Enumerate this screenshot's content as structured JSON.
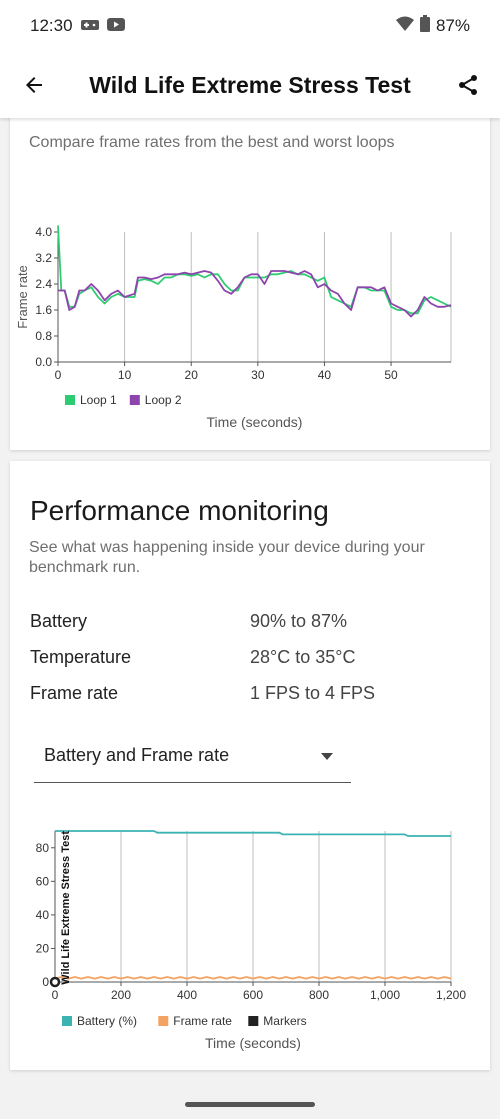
{
  "status_bar": {
    "time": "12:30",
    "battery": "87%"
  },
  "app_bar": {
    "title": "Wild Life Extreme Stress Test"
  },
  "loops_card": {
    "subtitle": "Compare frame rates from the best and worst loops"
  },
  "perf_card": {
    "title": "Performance monitoring",
    "subtitle_line1": "See what was happening inside your device during your",
    "subtitle_line2": "benchmark run.",
    "stats": {
      "battery_label": "Battery",
      "battery_value": "90% to 87%",
      "temperature_label": "Temperature",
      "temperature_value": "28°C to 35°C",
      "framerate_label": "Frame rate",
      "framerate_value": "1 FPS to 4 FPS"
    },
    "dropdown": {
      "selected": "Battery and Frame rate"
    }
  },
  "chart_data": [
    {
      "type": "line",
      "title": "",
      "xlabel": "Time (seconds)",
      "ylabel": "Frame rate",
      "xlim": [
        0,
        59
      ],
      "ylim": [
        0,
        4.0
      ],
      "x_ticks": [
        "0",
        "10",
        "20",
        "30",
        "40",
        "50"
      ],
      "y_ticks": [
        "0.0",
        "0.8",
        "1.6",
        "2.4",
        "3.2",
        "4.0"
      ],
      "legend_position": "bottom-left",
      "grid": "vertical",
      "series": [
        {
          "name": "Loop 1",
          "color": "#2ecc71",
          "points": [
            [
              0,
              4.2
            ],
            [
              0.5,
              2.2
            ],
            [
              1,
              2.2
            ],
            [
              1.7,
              1.7
            ],
            [
              2.5,
              1.7
            ],
            [
              3.2,
              2.1
            ],
            [
              4,
              2.2
            ],
            [
              5,
              2.3
            ],
            [
              6,
              2.0
            ],
            [
              7,
              1.8
            ],
            [
              8,
              2.0
            ],
            [
              9,
              2.1
            ],
            [
              10,
              2.0
            ],
            [
              11.5,
              2.0
            ],
            [
              12,
              2.5
            ],
            [
              13,
              2.55
            ],
            [
              14,
              2.5
            ],
            [
              15,
              2.4
            ],
            [
              16,
              2.6
            ],
            [
              17,
              2.6
            ],
            [
              18,
              2.7
            ],
            [
              19,
              2.7
            ],
            [
              20,
              2.65
            ],
            [
              21,
              2.7
            ],
            [
              22,
              2.6
            ],
            [
              23,
              2.7
            ],
            [
              24,
              2.7
            ],
            [
              25,
              2.4
            ],
            [
              26,
              2.2
            ],
            [
              27,
              2.2
            ],
            [
              28,
              2.6
            ],
            [
              29,
              2.6
            ],
            [
              30,
              2.6
            ],
            [
              31,
              2.6
            ],
            [
              32,
              2.7
            ],
            [
              33,
              2.7
            ],
            [
              34,
              2.75
            ],
            [
              35,
              2.8
            ],
            [
              36,
              2.7
            ],
            [
              37,
              2.7
            ],
            [
              38,
              2.6
            ],
            [
              39,
              2.5
            ],
            [
              40,
              2.6
            ],
            [
              41,
              2.0
            ],
            [
              42,
              1.9
            ],
            [
              43,
              1.8
            ],
            [
              44,
              1.7
            ],
            [
              45,
              2.3
            ],
            [
              46,
              2.3
            ],
            [
              47,
              2.2
            ],
            [
              48,
              2.2
            ],
            [
              49,
              2.2
            ],
            [
              50,
              1.7
            ],
            [
              51,
              1.6
            ],
            [
              52,
              1.6
            ],
            [
              53,
              1.5
            ],
            [
              54,
              1.5
            ],
            [
              55,
              1.9
            ],
            [
              56,
              2.0
            ],
            [
              57,
              1.9
            ],
            [
              58,
              1.8
            ],
            [
              59,
              1.7
            ]
          ]
        },
        {
          "name": "Loop 2",
          "color": "#8e44ad",
          "points": [
            [
              0,
              2.2
            ],
            [
              1,
              2.2
            ],
            [
              1.7,
              1.6
            ],
            [
              2.5,
              1.7
            ],
            [
              3.2,
              2.2
            ],
            [
              4,
              2.2
            ],
            [
              5,
              2.4
            ],
            [
              6,
              2.2
            ],
            [
              7,
              1.9
            ],
            [
              8,
              2.1
            ],
            [
              9,
              2.2
            ],
            [
              10,
              2.0
            ],
            [
              11.5,
              2.1
            ],
            [
              12,
              2.6
            ],
            [
              13,
              2.6
            ],
            [
              14,
              2.55
            ],
            [
              15,
              2.6
            ],
            [
              16,
              2.7
            ],
            [
              17,
              2.7
            ],
            [
              18,
              2.7
            ],
            [
              19,
              2.75
            ],
            [
              20,
              2.7
            ],
            [
              21,
              2.75
            ],
            [
              22,
              2.8
            ],
            [
              23,
              2.75
            ],
            [
              24,
              2.5
            ],
            [
              25,
              2.2
            ],
            [
              26,
              2.1
            ],
            [
              27,
              2.3
            ],
            [
              28,
              2.6
            ],
            [
              29,
              2.7
            ],
            [
              30,
              2.7
            ],
            [
              31,
              2.4
            ],
            [
              32,
              2.8
            ],
            [
              33,
              2.8
            ],
            [
              34,
              2.8
            ],
            [
              35,
              2.75
            ],
            [
              36,
              2.7
            ],
            [
              37,
              2.8
            ],
            [
              38,
              2.7
            ],
            [
              39,
              2.3
            ],
            [
              40,
              2.4
            ],
            [
              41,
              2.2
            ],
            [
              42,
              2.1
            ],
            [
              43,
              1.8
            ],
            [
              44,
              1.6
            ],
            [
              45,
              2.3
            ],
            [
              46,
              2.3
            ],
            [
              47,
              2.3
            ],
            [
              48,
              2.2
            ],
            [
              49,
              2.3
            ],
            [
              50,
              1.8
            ],
            [
              51,
              1.7
            ],
            [
              52,
              1.6
            ],
            [
              53,
              1.4
            ],
            [
              54,
              1.6
            ],
            [
              55,
              2.0
            ],
            [
              56,
              1.8
            ],
            [
              57,
              1.7
            ],
            [
              58,
              1.7
            ],
            [
              59,
              1.75
            ]
          ]
        }
      ]
    },
    {
      "type": "line",
      "title": "Wild Life Extreme Stress Test",
      "xlabel": "Time (seconds)",
      "ylabel": "",
      "xlim": [
        0,
        1200
      ],
      "ylim": [
        0,
        90
      ],
      "x_ticks": [
        "0",
        "200",
        "400",
        "600",
        "800",
        "1,000",
        "1,200"
      ],
      "y_ticks": [
        "0",
        "20",
        "40",
        "60",
        "80"
      ],
      "legend_position": "bottom-left",
      "grid": "vertical",
      "series": [
        {
          "name": "Battery (%)",
          "color": "#3bb3b3",
          "points": [
            [
              0,
              90
            ],
            [
              300,
              90
            ],
            [
              310,
              89
            ],
            [
              680,
              89
            ],
            [
              690,
              88
            ],
            [
              1060,
              88
            ],
            [
              1070,
              87
            ],
            [
              1200,
              87
            ]
          ]
        },
        {
          "name": "Frame rate",
          "color": "#f4a261",
          "points": [
            [
              0,
              2
            ],
            [
              20,
              3
            ],
            [
              40,
              2
            ],
            [
              60,
              3
            ],
            [
              80,
              2
            ],
            [
              100,
              3
            ],
            [
              120,
              2
            ],
            [
              140,
              3
            ],
            [
              160,
              2
            ],
            [
              180,
              3
            ],
            [
              200,
              2
            ],
            [
              220,
              3
            ],
            [
              240,
              2
            ],
            [
              260,
              3
            ],
            [
              280,
              2
            ],
            [
              300,
              3
            ],
            [
              320,
              2
            ],
            [
              340,
              3
            ],
            [
              360,
              2
            ],
            [
              380,
              3
            ],
            [
              400,
              2
            ],
            [
              420,
              3
            ],
            [
              440,
              2
            ],
            [
              460,
              3
            ],
            [
              480,
              2
            ],
            [
              500,
              3
            ],
            [
              520,
              2
            ],
            [
              540,
              3
            ],
            [
              560,
              2
            ],
            [
              580,
              3
            ],
            [
              600,
              2
            ],
            [
              620,
              3
            ],
            [
              640,
              2
            ],
            [
              660,
              3
            ],
            [
              680,
              2
            ],
            [
              700,
              3
            ],
            [
              720,
              2
            ],
            [
              740,
              3
            ],
            [
              760,
              2
            ],
            [
              780,
              3
            ],
            [
              800,
              2
            ],
            [
              820,
              3
            ],
            [
              840,
              2
            ],
            [
              860,
              3
            ],
            [
              880,
              2
            ],
            [
              900,
              3
            ],
            [
              920,
              2
            ],
            [
              940,
              3
            ],
            [
              960,
              2
            ],
            [
              980,
              3
            ],
            [
              1000,
              2
            ],
            [
              1020,
              3
            ],
            [
              1040,
              2
            ],
            [
              1060,
              3
            ],
            [
              1080,
              2
            ],
            [
              1100,
              3
            ],
            [
              1120,
              2
            ],
            [
              1140,
              3
            ],
            [
              1160,
              2
            ],
            [
              1180,
              3
            ],
            [
              1200,
              2
            ]
          ]
        },
        {
          "name": "Markers",
          "color": "#222222",
          "points": [
            [
              0,
              0
            ]
          ]
        }
      ]
    }
  ],
  "colors": {
    "accent": "#3bb3b3",
    "loop1": "#2ecc71",
    "loop2": "#8e44ad",
    "framerate": "#f4a261"
  }
}
